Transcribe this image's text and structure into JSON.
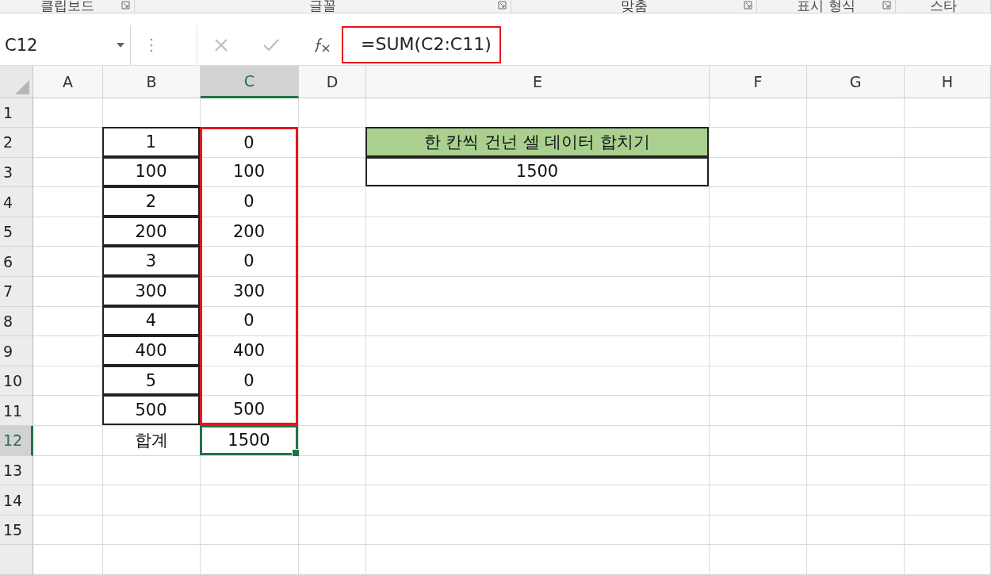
{
  "ribbon_groups": [
    {
      "label": "클립보드",
      "launcher": true
    },
    {
      "label": "글꼴",
      "launcher": true
    },
    {
      "label": "맞춤",
      "launcher": true
    },
    {
      "label": "표시 형식",
      "launcher": true
    },
    {
      "label": "스타",
      "launcher": false
    }
  ],
  "formula_bar": {
    "name_box": "C12",
    "formula": "=SUM(C2:C11)",
    "highlighted": true
  },
  "columns": [
    {
      "label": "A",
      "selected": false
    },
    {
      "label": "B",
      "selected": false
    },
    {
      "label": "C",
      "selected": true
    },
    {
      "label": "D",
      "selected": false
    },
    {
      "label": "E",
      "selected": false
    },
    {
      "label": "F",
      "selected": false
    },
    {
      "label": "G",
      "selected": false
    },
    {
      "label": "H",
      "selected": false
    }
  ],
  "rows": [
    {
      "label": "1",
      "selected": false,
      "cells": [
        null,
        null,
        null,
        null,
        null,
        null,
        null,
        null
      ]
    },
    {
      "label": "2",
      "selected": false,
      "cells": [
        null,
        {
          "text": "1",
          "kind": "bordered"
        },
        {
          "text": "0",
          "kind": "marked"
        },
        null,
        {
          "text": "한 칸씩 건넌 셀 데이터 합치기",
          "kind": "header"
        },
        null,
        null,
        null
      ]
    },
    {
      "label": "3",
      "selected": false,
      "cells": [
        null,
        {
          "text": "100",
          "kind": "bordered"
        },
        {
          "text": "100",
          "kind": "marked"
        },
        null,
        {
          "text": "1500",
          "kind": "bordered"
        },
        null,
        null,
        null
      ]
    },
    {
      "label": "4",
      "selected": false,
      "cells": [
        null,
        {
          "text": "2",
          "kind": "bordered"
        },
        {
          "text": "0",
          "kind": "marked"
        },
        null,
        null,
        null,
        null,
        null
      ]
    },
    {
      "label": "5",
      "selected": false,
      "cells": [
        null,
        {
          "text": "200",
          "kind": "bordered"
        },
        {
          "text": "200",
          "kind": "marked"
        },
        null,
        null,
        null,
        null,
        null
      ]
    },
    {
      "label": "6",
      "selected": false,
      "cells": [
        null,
        {
          "text": "3",
          "kind": "bordered"
        },
        {
          "text": "0",
          "kind": "marked"
        },
        null,
        null,
        null,
        null,
        null
      ]
    },
    {
      "label": "7",
      "selected": false,
      "cells": [
        null,
        {
          "text": "300",
          "kind": "bordered"
        },
        {
          "text": "300",
          "kind": "marked"
        },
        null,
        null,
        null,
        null,
        null
      ]
    },
    {
      "label": "8",
      "selected": false,
      "cells": [
        null,
        {
          "text": "4",
          "kind": "bordered"
        },
        {
          "text": "0",
          "kind": "marked"
        },
        null,
        null,
        null,
        null,
        null
      ]
    },
    {
      "label": "9",
      "selected": false,
      "cells": [
        null,
        {
          "text": "400",
          "kind": "bordered"
        },
        {
          "text": "400",
          "kind": "marked"
        },
        null,
        null,
        null,
        null,
        null
      ]
    },
    {
      "label": "10",
      "selected": false,
      "cells": [
        null,
        {
          "text": "5",
          "kind": "bordered"
        },
        {
          "text": "0",
          "kind": "marked"
        },
        null,
        null,
        null,
        null,
        null
      ]
    },
    {
      "label": "11",
      "selected": false,
      "cells": [
        null,
        {
          "text": "500",
          "kind": "bordered"
        },
        {
          "text": "500",
          "kind": "marked"
        },
        null,
        null,
        null,
        null,
        null
      ]
    },
    {
      "label": "12",
      "selected": true,
      "cells": [
        null,
        {
          "text": "합계",
          "kind": "plain"
        },
        {
          "text": "1500",
          "kind": "selected"
        },
        null,
        null,
        null,
        null,
        null
      ]
    },
    {
      "label": "13",
      "selected": false,
      "cells": [
        null,
        null,
        null,
        null,
        null,
        null,
        null,
        null
      ]
    },
    {
      "label": "14",
      "selected": false,
      "cells": [
        null,
        null,
        null,
        null,
        null,
        null,
        null,
        null
      ]
    },
    {
      "label": "15",
      "selected": false,
      "cells": [
        null,
        null,
        null,
        null,
        null,
        null,
        null,
        null
      ]
    },
    {
      "selected": false,
      "cells": [
        null,
        null,
        null,
        null,
        null,
        null,
        null,
        null
      ]
    }
  ]
}
